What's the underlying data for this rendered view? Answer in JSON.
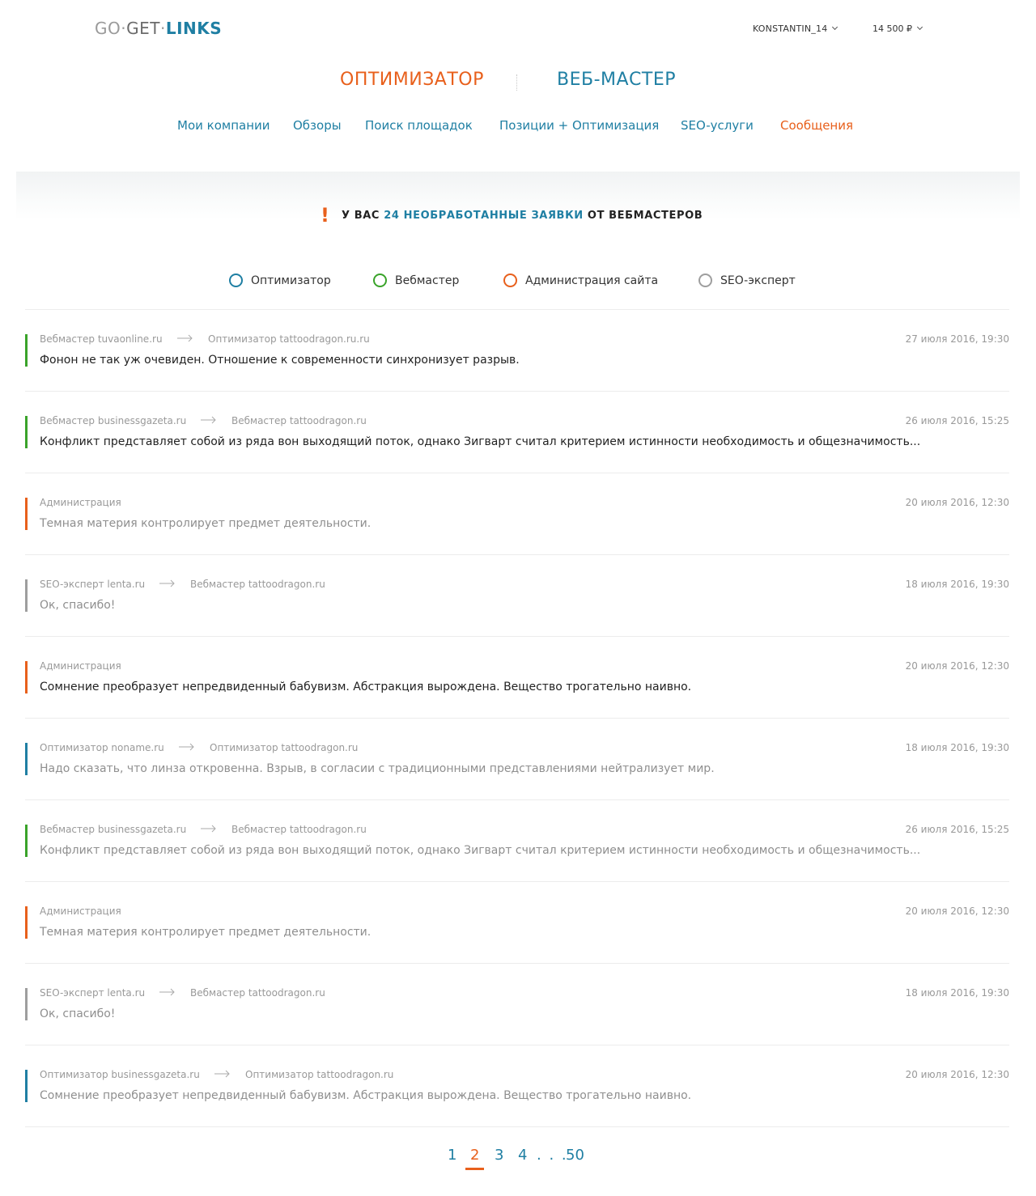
{
  "logo": {
    "part1": "GO",
    "dot1": "·",
    "part2": "GET",
    "dot2": "·",
    "part3": "LINKS"
  },
  "header": {
    "user": "KONSTANTIN_14",
    "balance": "14 500 ₽"
  },
  "roles": {
    "optimizer": "ОПТИМИЗАТОР",
    "webmaster": "ВЕБ-МАСТЕР"
  },
  "nav": [
    {
      "label": "Мои компании"
    },
    {
      "label": "Обзоры"
    },
    {
      "label": "Поиск площадок"
    },
    {
      "label": "Позиции + Оптимизация"
    },
    {
      "label": "SEO-услуги"
    },
    {
      "label": "Сообщения",
      "active": true
    }
  ],
  "alert": {
    "icon": "!",
    "prefix": "У ВАС",
    "highlight": "24 НЕОБРАБОТАННЫЕ ЗАЯВКИ",
    "suffix": "ОТ ВЕБМАСТЕРОВ"
  },
  "legend": [
    {
      "label": "Оптимизатор",
      "color": "#1f7fa3"
    },
    {
      "label": "Вебмастер",
      "color": "#3aa32a"
    },
    {
      "label": "Администрация сайта",
      "color": "#e8601c"
    },
    {
      "label": "SEO-эксперт",
      "color": "#9e9e9e"
    }
  ],
  "arrow_icon": "long-arrow-right-icon",
  "messages": [
    {
      "from": "Вебмастер tuvaonline.ru",
      "to": "Оптимизатор tattoodragon.ru.ru",
      "date": "27 июля 2016, 19:30",
      "text": "Фонон не так уж очевиден. Отношение к современности синхронизует разрыв.",
      "color": "#3aa32a",
      "unread": true
    },
    {
      "from": "Вебмастер businessgazeta.ru",
      "to": "Вебмастер tattoodragon.ru",
      "date": "26 июля 2016, 15:25",
      "text": "Конфликт представляет собой из ряда вон выходящий поток, однако Зигварт считал критерием истинности необходимость и общезначимость...",
      "color": "#3aa32a",
      "unread": true
    },
    {
      "from": "Администрация",
      "to": "",
      "date": "20 июля 2016, 12:30",
      "text": "Темная материя контролирует предмет деятельности.",
      "color": "#e8601c",
      "unread": false
    },
    {
      "from": "SEO-эксперт lenta.ru",
      "to": "Вебмастер tattoodragon.ru",
      "date": "18 июля 2016, 19:30",
      "text": "Ок, спасибо!",
      "color": "#9e9e9e",
      "unread": false
    },
    {
      "from": "Администрация",
      "to": "",
      "date": "20 июля 2016, 12:30",
      "text": "Сомнение преобразует непредвиденный бабувизм. Абстракция вырождена. Вещество трогательно наивно.",
      "color": "#e8601c",
      "unread": true
    },
    {
      "from": "Оптимизатор noname.ru",
      "to": "Оптимизатор tattoodragon.ru",
      "date": "18 июля 2016, 19:30",
      "text": "Надо сказать, что линза откровенна. Взрыв, в согласии с традиционными представлениями нейтрализует мир.",
      "color": "#1f7fa3",
      "unread": false
    },
    {
      "from": "Вебмастер businessgazeta.ru",
      "to": "Вебмастер tattoodragon.ru",
      "date": "26 июля 2016, 15:25",
      "text": "Конфликт представляет собой из ряда вон выходящий поток, однако Зигварт считал критерием истинности необходимость и общезначимость...",
      "color": "#3aa32a",
      "unread": false
    },
    {
      "from": "Администрация",
      "to": "",
      "date": "20 июля 2016, 12:30",
      "text": "Темная материя контролирует предмет деятельности.",
      "color": "#e8601c",
      "unread": false
    },
    {
      "from": "SEO-эксперт lenta.ru",
      "to": "Вебмастер tattoodragon.ru",
      "date": "18 июля 2016, 19:30",
      "text": "Ок, спасибо!",
      "color": "#9e9e9e",
      "unread": false
    },
    {
      "from": "Оптимизатор businessgazeta.ru",
      "to": "Оптимизатор tattoodragon.ru",
      "date": "20 июля 2016, 12:30",
      "text": "Сомнение преобразует непредвиденный бабувизм. Абстракция вырождена. Вещество трогательно наивно.",
      "color": "#1f7fa3",
      "unread": false
    }
  ],
  "pagination": {
    "pages": [
      "1",
      "2",
      "3",
      "4"
    ],
    "current": "2",
    "ellipsis": ". . .",
    "last": "50"
  },
  "colors": {
    "accent_orange": "#e8601c",
    "accent_blue": "#1f7fa3"
  }
}
